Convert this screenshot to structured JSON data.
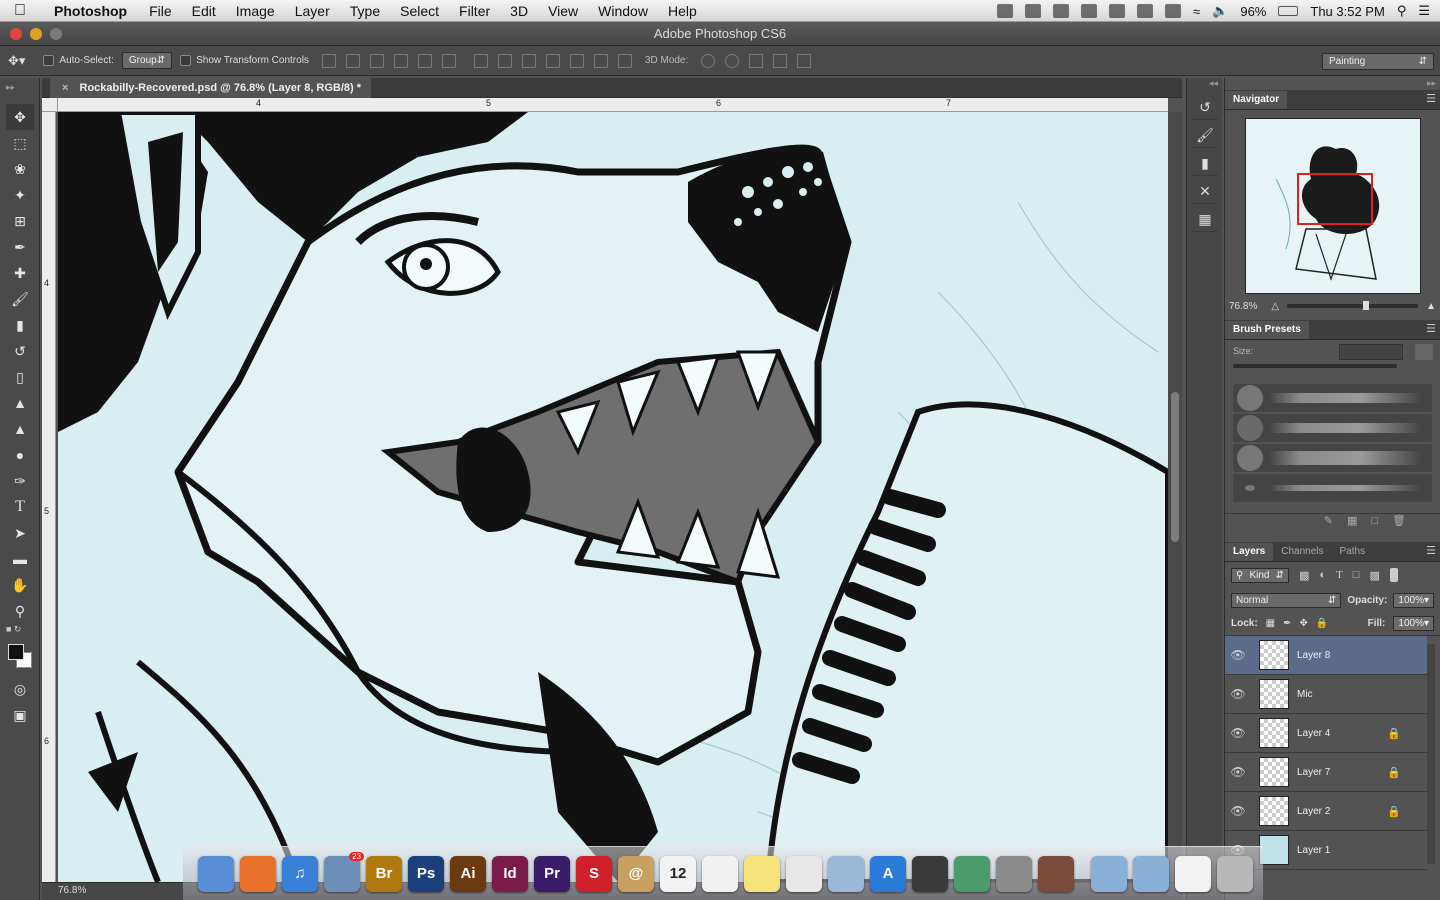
{
  "menubar": {
    "app": "Photoshop",
    "items": [
      "File",
      "Edit",
      "Image",
      "Layer",
      "Type",
      "Select",
      "Filter",
      "3D",
      "View",
      "Window",
      "Help"
    ],
    "battery": "96%",
    "clock": "Thu 3:52 PM"
  },
  "window": {
    "title": "Adobe Photoshop CS6"
  },
  "options": {
    "auto_select_label": "Auto-Select:",
    "auto_select_value": "Group",
    "transform_label": "Show Transform Controls",
    "mode3d_label": "3D Mode:",
    "workspace": "Painting"
  },
  "document": {
    "tab_title": "Rockabilly-Recovered.psd @ 76.8% (Layer 8, RGB/8) *",
    "zoom": "76.8%"
  },
  "ruler": {
    "h_labels": [
      "4",
      "5",
      "6",
      "7"
    ],
    "v_labels": [
      "4",
      "5",
      "6"
    ]
  },
  "navigator": {
    "tab": "Navigator",
    "zoom": "76.8%"
  },
  "brush_presets": {
    "tab": "Brush Presets",
    "size_label": "Size:"
  },
  "layers_panel": {
    "tabs": [
      "Layers",
      "Channels",
      "Paths"
    ],
    "filter": "Kind",
    "blend_mode": "Normal",
    "opacity_label": "Opacity:",
    "opacity": "100%",
    "lock_label": "Lock:",
    "fill_label": "Fill:",
    "fill": "100%",
    "layers": [
      {
        "name": "Layer 8",
        "selected": true,
        "locked": false
      },
      {
        "name": "Mic",
        "selected": false,
        "locked": false
      },
      {
        "name": "Layer 4",
        "selected": false,
        "locked": true
      },
      {
        "name": "Layer 7",
        "selected": false,
        "locked": true
      },
      {
        "name": "Layer 2",
        "selected": false,
        "locked": true
      },
      {
        "name": "Layer 1",
        "selected": false,
        "locked": false
      }
    ]
  },
  "dock": {
    "items": [
      {
        "name": "finder",
        "label": "",
        "color": "#5a8fd8"
      },
      {
        "name": "firefox",
        "label": "",
        "color": "#e8702a"
      },
      {
        "name": "itunes",
        "label": "♫",
        "color": "#3a7fd8"
      },
      {
        "name": "mail-bird",
        "label": "",
        "color": "#6b8fb8",
        "badge": "23"
      },
      {
        "name": "bridge",
        "label": "Br",
        "color": "#b07a10"
      },
      {
        "name": "photoshop",
        "label": "Ps",
        "color": "#1b3f7a"
      },
      {
        "name": "illustrator",
        "label": "Ai",
        "color": "#6b3a10"
      },
      {
        "name": "indesign",
        "label": "Id",
        "color": "#7a1b4a"
      },
      {
        "name": "premiere",
        "label": "Pr",
        "color": "#3a1b6a"
      },
      {
        "name": "sketchbook",
        "label": "S",
        "color": "#d0202a"
      },
      {
        "name": "contacts",
        "label": "@",
        "color": "#c8a060"
      },
      {
        "name": "calendar",
        "label": "12",
        "color": "#f2f2f2"
      },
      {
        "name": "reminders",
        "label": "",
        "color": "#f0f0f0"
      },
      {
        "name": "notes",
        "label": "",
        "color": "#f5e27a"
      },
      {
        "name": "textedit",
        "label": "",
        "color": "#e8e8e8"
      },
      {
        "name": "preview",
        "label": "",
        "color": "#9ab8d8"
      },
      {
        "name": "appstore",
        "label": "A",
        "color": "#2a7ad8"
      },
      {
        "name": "facetime",
        "label": "",
        "color": "#3a3a3a"
      },
      {
        "name": "iphoto",
        "label": "",
        "color": "#4a9a6a"
      },
      {
        "name": "system-prefs",
        "label": "",
        "color": "#8a8a8a"
      },
      {
        "name": "photo-booth",
        "label": "",
        "color": "#7a4a3a"
      },
      {
        "name": "folder-1",
        "label": "",
        "color": "#8ab0d8"
      },
      {
        "name": "folder-2",
        "label": "",
        "color": "#8ab0d8"
      },
      {
        "name": "document",
        "label": "",
        "color": "#f2f2f2"
      },
      {
        "name": "trash",
        "label": "",
        "color": "#b8b8b8"
      }
    ]
  }
}
